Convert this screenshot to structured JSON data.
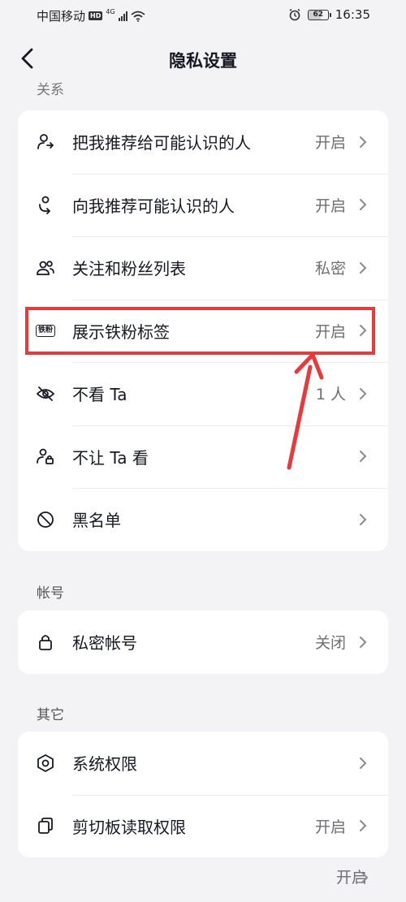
{
  "status_bar": {
    "carrier": "中国移动",
    "hd_badge": "HD",
    "network": "4G",
    "battery": "62",
    "battery_level_percent": 62,
    "time": "16:35"
  },
  "header": {
    "title": "隐私设置"
  },
  "sections": [
    {
      "label": "关系",
      "rows": [
        {
          "label": "把我推荐给可能认识的人",
          "value": "开启",
          "icon": "recommend-me-icon"
        },
        {
          "label": "向我推荐可能认识的人",
          "value": "开启",
          "icon": "recommend-to-me-icon"
        },
        {
          "label": "关注和粉丝列表",
          "value": "私密",
          "icon": "followers-icon"
        },
        {
          "label": "展示铁粉标签",
          "value": "开启",
          "icon": "fan-badge-icon",
          "badge_text": "铁粉"
        },
        {
          "label": "不看 Ta",
          "value": "1 人",
          "icon": "eye-off-icon"
        },
        {
          "label": "不让 Ta 看",
          "value": "",
          "icon": "user-lock-icon"
        },
        {
          "label": "黑名单",
          "value": "",
          "icon": "block-icon"
        }
      ]
    },
    {
      "label": "帐号",
      "rows": [
        {
          "label": "私密帐号",
          "value": "关闭",
          "icon": "lock-icon"
        }
      ]
    },
    {
      "label": "其它",
      "rows": [
        {
          "label": "系统权限",
          "value": "",
          "icon": "hexagon-settings-icon"
        },
        {
          "label": "剪切板读取权限",
          "value": "开启",
          "icon": "clipboard-icon"
        }
      ]
    }
  ],
  "bottom_peek_value": "开启",
  "colors": {
    "background": "#f3f3f5",
    "card": "#ffffff",
    "annotation_red": "#e83a3a",
    "text_primary": "#161823",
    "text_secondary": "#6e6e73"
  }
}
